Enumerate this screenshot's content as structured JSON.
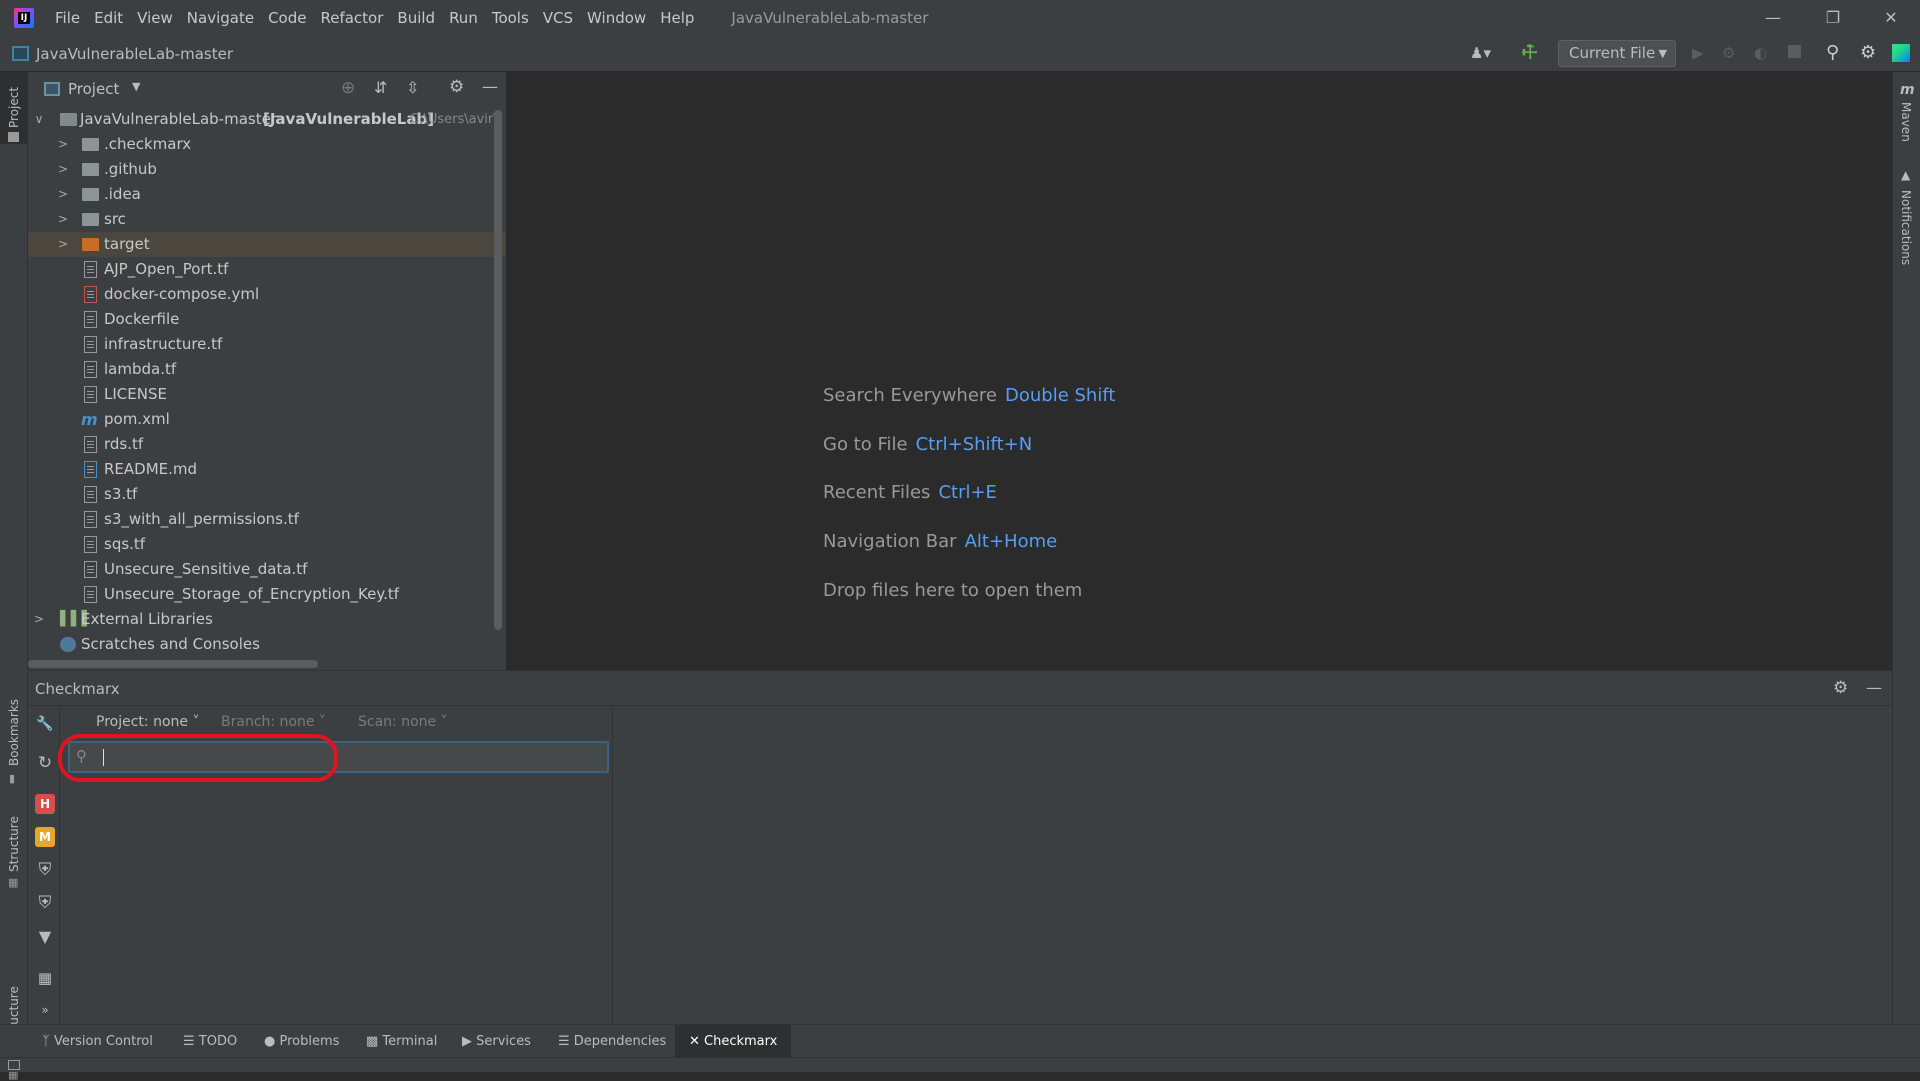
{
  "window": {
    "title": "JavaVulnerableLab-master",
    "menu": [
      "File",
      "Edit",
      "View",
      "Navigate",
      "Code",
      "Refactor",
      "Build",
      "Run",
      "Tools",
      "VCS",
      "Window",
      "Help"
    ]
  },
  "navbar": {
    "project_name": "JavaVulnerableLab-master",
    "run_config": "Current File"
  },
  "left_tool_tabs": [
    "Project",
    "Bookmarks",
    "Structure",
    "JPA Structure"
  ],
  "right_tool_tabs": [
    "Maven",
    "Notifications"
  ],
  "project_panel": {
    "title": "Project",
    "root": {
      "name": "JavaVulnerableLab-master",
      "module": "[JavaVulnerableLab]",
      "path": "C:\\Users\\avir\\"
    },
    "folders": [
      ".checkmarx",
      ".github",
      ".idea",
      "src",
      "target"
    ],
    "files": [
      "AJP_Open_Port.tf",
      "docker-compose.yml",
      "Dockerfile",
      "infrastructure.tf",
      "lambda.tf",
      "LICENSE",
      "pom.xml",
      "rds.tf",
      "README.md",
      "s3.tf",
      "s3_with_all_permissions.tf",
      "sqs.tf",
      "Unsecure_Sensitive_data.tf",
      "Unsecure_Storage_of_Encryption_Key.tf"
    ],
    "extra": [
      "External Libraries",
      "Scratches and Consoles"
    ]
  },
  "editor_hints": [
    {
      "label": "Search Everywhere",
      "key": "Double Shift"
    },
    {
      "label": "Go to File",
      "key": "Ctrl+Shift+N"
    },
    {
      "label": "Recent Files",
      "key": "Ctrl+E"
    },
    {
      "label": "Navigation Bar",
      "key": "Alt+Home"
    },
    {
      "label": "Drop files here to open them",
      "key": ""
    }
  ],
  "checkmarx": {
    "title": "Checkmarx",
    "project_dropdown": "Project: none",
    "branch_dropdown": "Branch: none",
    "scan_dropdown": "Scan: none",
    "search_value": "",
    "severity_icons": [
      "H",
      "M",
      "L"
    ]
  },
  "status_tabs": [
    "Version Control",
    "TODO",
    "Problems",
    "Terminal",
    "Services",
    "Dependencies",
    "Checkmarx"
  ],
  "colors": {
    "accent": "#589df6",
    "highlight_circle": "#e0141e",
    "selected_row": "#4b473e"
  }
}
